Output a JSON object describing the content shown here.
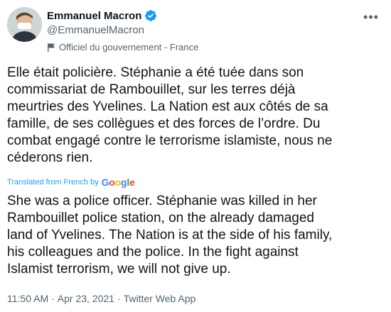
{
  "author": {
    "name": "Emmanuel Macron",
    "handle": "@EmmanuelMacron",
    "label": "Officiel du gouvernement - France",
    "verified": true
  },
  "tweet": {
    "text": "Elle était policière. Stéphanie a été tuée dans son\ncommissariat de Rambouillet, sur les terres déjà\nmeurtries des Yvelines. La Nation est aux côtés de sa\nfamille, de ses collègues et des forces de l’ordre. Du\ncombat engagé contre le terrorisme islamiste, nous ne\ncéderons rien.",
    "translated_from": "Translated from French by",
    "translator": "Google",
    "translation": "She was a police officer. Stéphanie was killed in her\nRambouillet police station, on the already damaged\nland of Yvelines. The Nation is at the side of his family,\nhis colleagues and the police. In the fight against\nIslamist terrorism, we will not give up.",
    "time": "11:50 AM",
    "date": "Apr 23, 2021",
    "source": "Twitter Web App",
    "separator": "·"
  },
  "icons": {
    "verified": "verified-badge-icon",
    "label": "flag-icon",
    "more": "more-options-icon"
  },
  "colors": {
    "accent": "#1d9bf0",
    "text": "#0f1419",
    "secondary": "#536471"
  }
}
